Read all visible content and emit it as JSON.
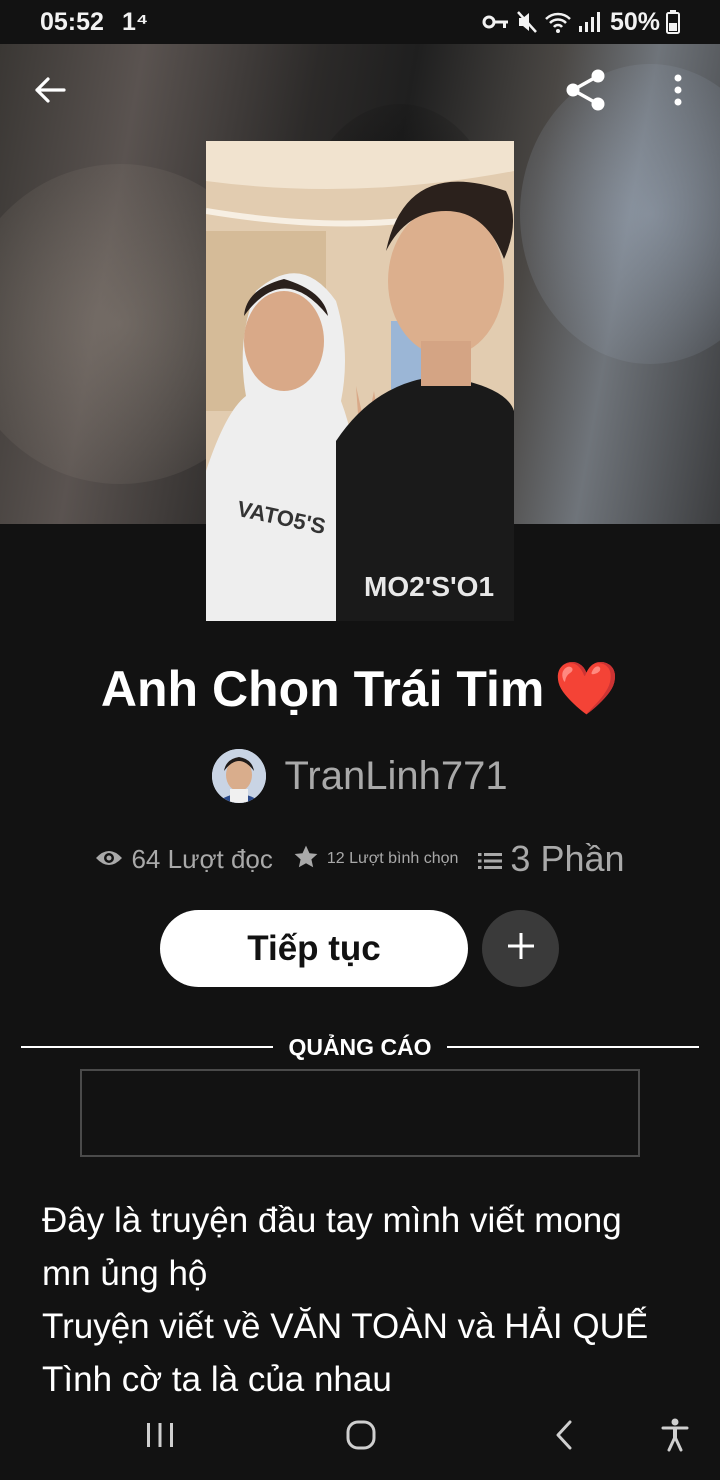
{
  "status_bar": {
    "time": "05:52",
    "extra": "1⁴",
    "battery": "50%",
    "icons": [
      "vpn-key-icon",
      "mute-icon",
      "wifi-icon",
      "signal-icon",
      "battery-icon"
    ]
  },
  "header": {
    "back_icon": "arrow-left-icon",
    "share_icon": "share-icon",
    "more_icon": "more-vertical-icon"
  },
  "story": {
    "title": "Anh Chọn Trái Tim",
    "title_emoji": "❤️",
    "author": "TranLinh771",
    "reads": "64 Lượt đọc",
    "votes": "12 Lượt bình chọn",
    "parts": "3 Phần"
  },
  "actions": {
    "continue_label": "Tiếp tục",
    "add_icon": "plus-icon"
  },
  "ad": {
    "label": "QUẢNG CÁO"
  },
  "description": {
    "lines": [
      "Đây là truyện đầu tay mình viết mong",
      "mn ủng hộ",
      "Truyện viết về VĂN TOÀN và HẢI QUẾ",
      "Tình cờ ta là của nhau"
    ]
  },
  "nav": {
    "icons": [
      "recent-apps-icon",
      "home-icon",
      "back-icon",
      "accessibility-icon"
    ]
  },
  "colors": {
    "background": "#121212",
    "button": "#ffffff",
    "secondary_text": "#a9a9a9",
    "heart": "#e5282e"
  }
}
